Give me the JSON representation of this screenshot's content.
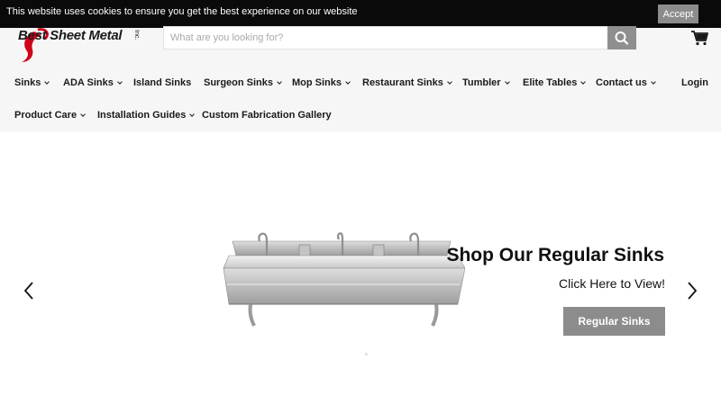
{
  "cookie_bar": {
    "message": "This website uses cookies to ensure you get the best experience on our website",
    "accept_label": "Accept"
  },
  "brand": {
    "logo_text": "Best Sheet Metal",
    "logo_suffix": "Inc.",
    "accent_color": "#d0021b"
  },
  "search": {
    "placeholder": "What are you looking for?",
    "value": ""
  },
  "nav": {
    "row1": [
      {
        "label": "Sinks",
        "has_dropdown": true
      },
      {
        "label": "ADA Sinks",
        "has_dropdown": true
      },
      {
        "label": "Island Sinks",
        "has_dropdown": false
      },
      {
        "label": "Surgeon Sinks",
        "has_dropdown": true
      },
      {
        "label": "Mop Sinks",
        "has_dropdown": true
      },
      {
        "label": "Restaurant Sinks",
        "has_dropdown": true
      },
      {
        "label": "Tumbler",
        "has_dropdown": true
      },
      {
        "label": "Elite Tables",
        "has_dropdown": true
      },
      {
        "label": "Contact us",
        "has_dropdown": true
      }
    ],
    "row2": [
      {
        "label": "Product Care",
        "has_dropdown": true
      },
      {
        "label": "Installation Guides",
        "has_dropdown": true
      },
      {
        "label": "Custom Fabrication Gallery",
        "has_dropdown": false
      }
    ],
    "login_label": "Login"
  },
  "hero": {
    "title": "Shop Our Regular Sinks",
    "subtitle": "Click Here to View!",
    "button_label": "Regular Sinks",
    "button_color": "#8c8c8c"
  }
}
